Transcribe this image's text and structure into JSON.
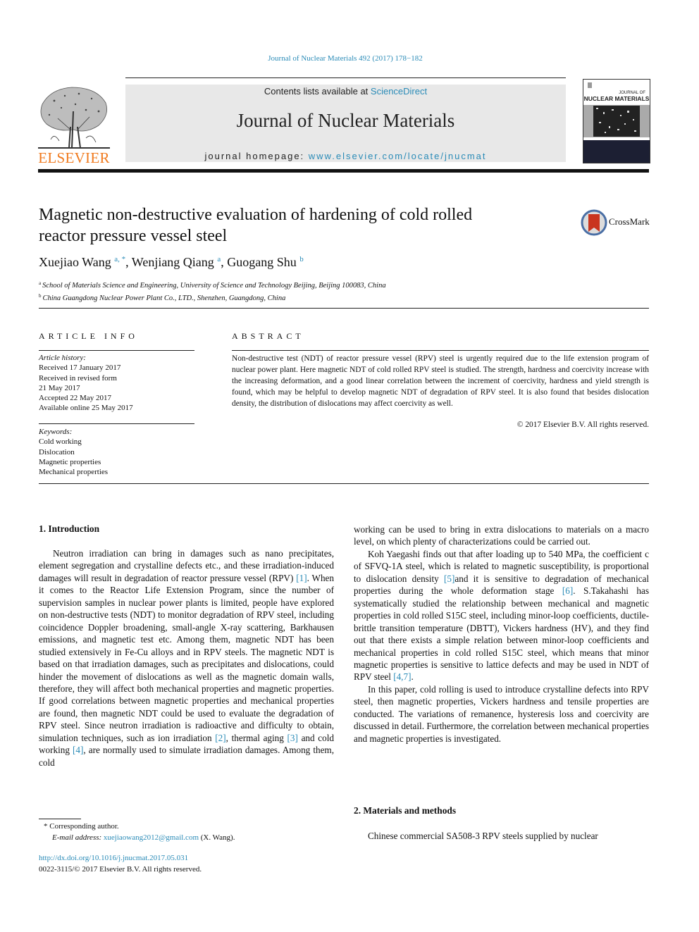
{
  "running_head": "Journal of Nuclear Materials 492 (2017) 178−182",
  "header": {
    "publisher_logo_text": "ELSEVIER",
    "contents_prefix": "Contents lists available at ",
    "contents_link": "ScienceDirect",
    "journal_title": "Journal of Nuclear Materials",
    "homepage_prefix": "journal homepage: ",
    "homepage_link": "www.elsevier.com/locate/jnucmat",
    "cover_title_top": "JOURNAL OF",
    "cover_title_main": "NUCLEAR MATERIALS"
  },
  "title": {
    "line1": "Magnetic non-destructive evaluation of hardening of cold rolled",
    "line2": "reactor pressure vessel steel"
  },
  "crossmark_label": "CrossMark",
  "authors": [
    {
      "name": "Xuejiao Wang",
      "sup": "a, *"
    },
    {
      "name": "Wenjiang Qiang",
      "sup": "a"
    },
    {
      "name": "Guogang Shu",
      "sup": "b"
    }
  ],
  "affiliations": [
    {
      "mark": "a",
      "text": "School of Materials Science and Engineering, University of Science and Technology Beijing, Beijing 100083, China"
    },
    {
      "mark": "b",
      "text": "China Guangdong Nuclear Power Plant Co., LTD., Shenzhen, Guangdong, China"
    }
  ],
  "article_info": {
    "heading": "ARTICLE INFO",
    "history_label": "Article history:",
    "history": [
      "Received 17 January 2017",
      "Received in revised form",
      "21 May 2017",
      "Accepted 22 May 2017",
      "Available online 25 May 2017"
    ],
    "keywords_label": "Keywords:",
    "keywords": [
      "Cold working",
      "Dislocation",
      "Magnetic properties",
      "Mechanical properties"
    ]
  },
  "abstract": {
    "heading": "ABSTRACT",
    "text": "Non-destructive test (NDT) of reactor pressure vessel (RPV) steel is urgently required due to the life extension program of nuclear power plant. Here magnetic NDT of cold rolled RPV steel is studied. The strength, hardness and coercivity increase with the increasing deformation, and a good linear correlation between the increment of coercivity, hardness and yield strength is found, which may be helpful to develop magnetic NDT of degradation of RPV steel. It is also found that besides dislocation density, the distribution of dislocations may affect coercivity as well.",
    "copyright": "© 2017 Elsevier B.V. All rights reserved."
  },
  "sections": {
    "intro_heading": "1.  Introduction",
    "intro_p1": [
      {
        "t": "Neutron irradiation can bring in damages such as nano precipitates, element segregation and crystalline defects etc., and these irradiation-induced damages will result in degradation of reactor pressure vessel (RPV) "
      },
      {
        "ref": "[1]"
      },
      {
        "t": ". When it comes to the Reactor Life Extension Program, since the number of supervision samples in nuclear power plants is limited, people have explored on non-destructive tests (NDT) to monitor degradation of RPV steel, including coincidence Doppler broadening, small-angle X-ray scattering, Barkhausen emissions, and magnetic test etc. Among them, magnetic NDT has been studied extensively in Fe-Cu alloys and in RPV steels. The magnetic NDT is based on that irradiation damages, such as precipitates and dislocations, could hinder the movement of dislocations as well as the magnetic domain walls, therefore, they will affect both mechanical properties and magnetic properties. If good correlations between magnetic properties and mechanical properties are found, then magnetic NDT could be used to evaluate the degradation of RPV steel. Since neutron irradiation is radioactive and difficulty to obtain, simulation techniques, such as ion irradiation "
      },
      {
        "ref": "[2]"
      },
      {
        "t": ", thermal aging "
      },
      {
        "ref": "[3]"
      },
      {
        "t": " and cold working "
      },
      {
        "ref": "[4]"
      },
      {
        "t": ", are normally used to simulate irradiation damages. Among them, cold"
      }
    ],
    "intro_p1_cont": "working can be used to bring in extra dislocations to materials on a macro level, on which plenty of characterizations could be carried out.",
    "intro_p2": [
      {
        "t": "Koh Yaegashi finds out that after loading up to 540 MPa, the coefficient c of SFVQ-1A steel, which is related to magnetic susceptibility, is proportional to dislocation density "
      },
      {
        "ref": "[5]"
      },
      {
        "t": "and it is sensitive to degradation of mechanical properties during the whole deformation stage "
      },
      {
        "ref": "[6]"
      },
      {
        "t": ". S.Takahashi has systematically studied the relationship between mechanical and magnetic properties in cold rolled S15C steel, including minor-loop coefficients, ductile-brittle transition temperature (DBTT), Vickers hardness (HV), and they find out that there exists a simple relation between minor-loop coefficients and mechanical properties in cold rolled S15C steel, which means that minor magnetic properties is sensitive to lattice defects and may be used in NDT of RPV steel "
      },
      {
        "ref": "[4,7]"
      },
      {
        "t": "."
      }
    ],
    "intro_p3": "In this paper, cold rolling is used to introduce crystalline defects into RPV steel, then magnetic properties, Vickers hardness and tensile properties are conducted. The variations of remanence, hysteresis loss and coercivity are discussed in detail. Furthermore, the correlation between mechanical properties and magnetic properties is investigated.",
    "methods_heading": "2.  Materials and methods",
    "methods_p1": "Chinese commercial SA508-3 RPV steels supplied by nuclear"
  },
  "footnote": {
    "corresponding": "* Corresponding author.",
    "email_label": "E-mail address: ",
    "email": "xuejiaowang2012@gmail.com",
    "email_suffix": " (X. Wang)."
  },
  "doi": "http://dx.doi.org/10.1016/j.jnucmat.2017.05.031",
  "issn_line": "0022-3115/© 2017 Elsevier B.V. All rights reserved."
}
